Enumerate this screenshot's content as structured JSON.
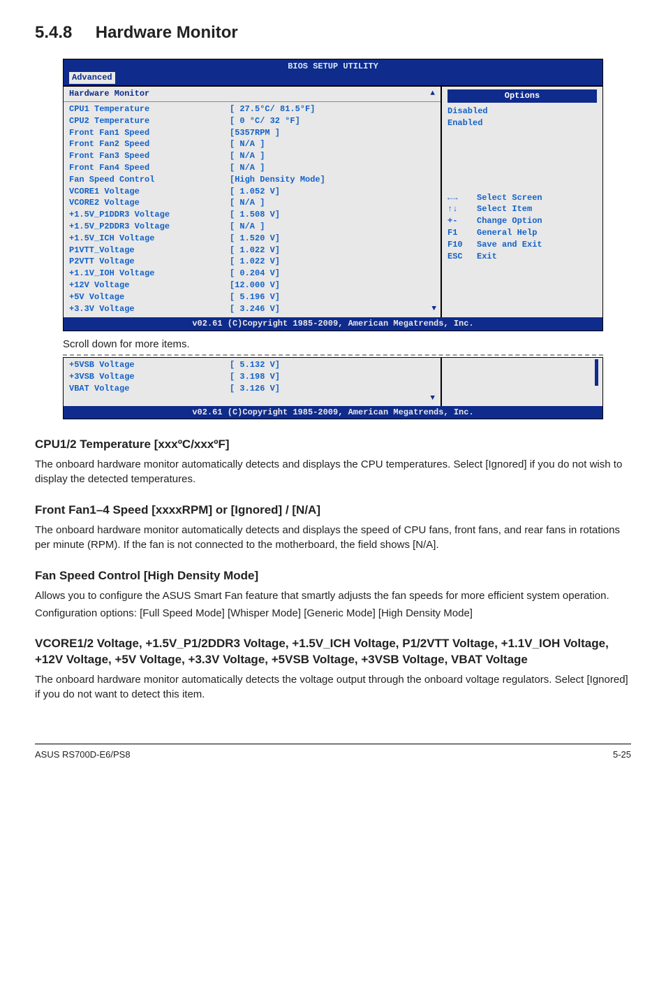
{
  "section_number": "5.4.8",
  "section_title": "Hardware Monitor",
  "bios": {
    "title": "BIOS SETUP UTILITY",
    "tab": "Advanced",
    "panel_title": "Hardware Monitor",
    "rows": [
      {
        "k": "CPU1 Temperature",
        "v": "[ 27.5°C/ 81.5°F]"
      },
      {
        "k": "CPU2 Temperature",
        "v": "[ 0   °C/ 32  °F]"
      },
      {
        "k": "Front Fan1 Speed",
        "v": "[5357RPM ]"
      },
      {
        "k": "Front Fan2 Speed",
        "v": "[  N/A  ]"
      },
      {
        "k": "Front Fan3 Speed",
        "v": "[  N/A  ]"
      },
      {
        "k": "Front Fan4 Speed",
        "v": "[  N/A  ]"
      },
      {
        "k": "Fan Speed Control",
        "v": "[High Density Mode]"
      },
      {
        "k": "VCORE1 Voltage",
        "v": "[ 1.052 V]"
      },
      {
        "k": "VCORE2 Voltage",
        "v": "[  N/A  ]"
      },
      {
        "k": "+1.5V_P1DDR3 Voltage",
        "v": "[ 1.508 V]"
      },
      {
        "k": "+1.5V_P2DDR3 Voltage",
        "v": "[  N/A  ]"
      },
      {
        "k": "+1.5V_ICH Voltage",
        "v": "[ 1.520 V]"
      },
      {
        "k": "P1VTT_Voltage",
        "v": "[ 1.022 V]"
      },
      {
        "k": "P2VTT Voltage",
        "v": "[ 1.022 V]"
      },
      {
        "k": "+1.1V_IOH Voltage",
        "v": "[ 0.204 V]"
      },
      {
        "k": "+12V Voltage",
        "v": "[12.000 V]"
      },
      {
        "k": "+5V Voltage",
        "v": "[ 5.196 V]"
      },
      {
        "k": "+3.3V Voltage",
        "v": "[ 3.246 V]"
      }
    ],
    "options_title": "Options",
    "options": [
      "Disabled",
      "Enabled"
    ],
    "help": [
      {
        "k": "←→",
        "v": "Select Screen"
      },
      {
        "k": "↑↓",
        "v": "Select Item"
      },
      {
        "k": "+-",
        "v": "Change Option"
      },
      {
        "k": "F1",
        "v": "General Help"
      },
      {
        "k": "F10",
        "v": "Save and Exit"
      },
      {
        "k": "ESC",
        "v": "Exit"
      }
    ],
    "copyright": "v02.61 (C)Copyright 1985-2009, American Megatrends, Inc."
  },
  "scroll_note": "Scroll down for more items.",
  "bios2_rows": [
    {
      "k": "+5VSB Voltage",
      "v": "[ 5.132 V]"
    },
    {
      "k": "+3VSB Voltage",
      "v": "[ 3.198 V]"
    },
    {
      "k": "VBAT Voltage",
      "v": "[ 3.126 V]"
    }
  ],
  "sub1": {
    "title": "CPU1/2 Temperature [xxxºC/xxxºF]",
    "body": "The onboard hardware monitor automatically detects and displays the CPU temperatures. Select [Ignored] if you do not wish to display the detected temperatures."
  },
  "sub2": {
    "title": "Front Fan1–4 Speed [xxxxRPM] or [Ignored] / [N/A]",
    "body": "The onboard hardware monitor automatically detects and displays the speed of CPU fans, front fans, and rear fans in rotations per minute (RPM). If the fan is not connected to the motherboard, the field shows [N/A]."
  },
  "sub3": {
    "title": "Fan Speed Control [High Density Mode]",
    "body1": "Allows you to configure the ASUS Smart Fan feature that smartly adjusts the fan speeds for more efficient system operation.",
    "body2": "Configuration options: [Full Speed Mode] [Whisper Mode] [Generic Mode] [High Density Mode]"
  },
  "sub4": {
    "title": "VCORE1/2 Voltage, +1.5V_P1/2DDR3 Voltage, +1.5V_ICH Voltage, P1/2VTT Voltage, +1.1V_IOH Voltage, +12V Voltage, +5V Voltage, +3.3V Voltage, +5VSB Voltage, +3VSB Voltage, VBAT Voltage",
    "body": "The onboard hardware monitor automatically detects the voltage output through the onboard voltage regulators. Select [Ignored] if you do not want to detect this item."
  },
  "footer_left": "ASUS RS700D-E6/PS8",
  "footer_right": "5-25"
}
